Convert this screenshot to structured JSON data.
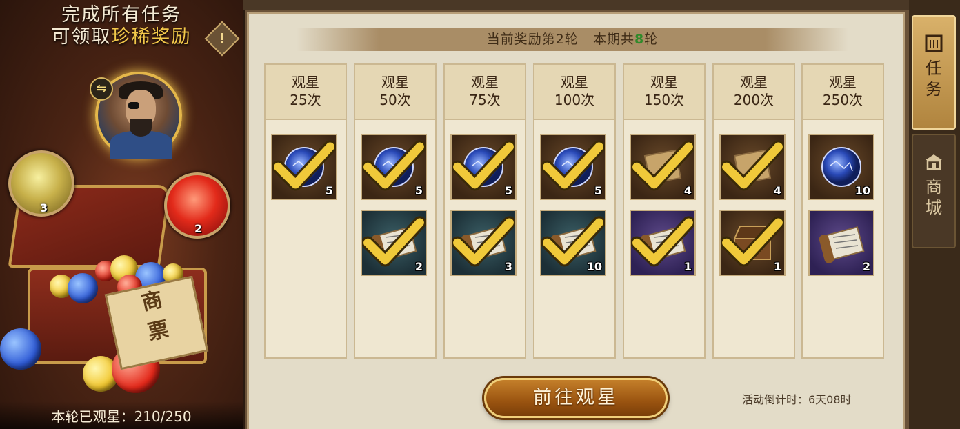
{
  "left_panel": {
    "title_line1": "完成所有任务",
    "title_line2_prefix": "可领取",
    "title_line2_highlight": "珍稀奖励",
    "warning_glyph": "!",
    "swap_glyph": "⇋",
    "gold_orb_count": "3",
    "red_orb_count": "2",
    "ticket_text_1": "商",
    "ticket_text_2": "票",
    "progress_text": "本轮已观星：210/250"
  },
  "banner": {
    "prefix": "当前奖励第2轮",
    "middle": "本期共",
    "total": "8",
    "suffix": "轮"
  },
  "columns": [
    {
      "line1": "观星",
      "line2": "25次",
      "items": [
        {
          "type": "star-orb",
          "bg": "brown",
          "count": "5"
        }
      ]
    },
    {
      "line1": "观星",
      "line2": "50次",
      "items": [
        {
          "type": "star-orb",
          "bg": "brown",
          "count": "5"
        },
        {
          "type": "scroll",
          "bg": "teal",
          "count": "2"
        }
      ]
    },
    {
      "line1": "观星",
      "line2": "75次",
      "items": [
        {
          "type": "star-orb",
          "bg": "brown",
          "count": "5"
        },
        {
          "type": "scroll",
          "bg": "teal",
          "count": "3"
        }
      ]
    },
    {
      "line1": "观星",
      "line2": "100次",
      "items": [
        {
          "type": "star-orb",
          "bg": "brown",
          "count": "5"
        },
        {
          "type": "scroll",
          "bg": "teal",
          "count": "10"
        }
      ]
    },
    {
      "line1": "观星",
      "line2": "150次",
      "items": [
        {
          "type": "paper",
          "bg": "brown",
          "count": "4"
        },
        {
          "type": "scroll",
          "bg": "purple",
          "count": "1"
        }
      ]
    },
    {
      "line1": "观星",
      "line2": "200次",
      "items": [
        {
          "type": "paper",
          "bg": "brown",
          "count": "4"
        },
        {
          "type": "chest",
          "bg": "brown",
          "count": "1"
        }
      ]
    },
    {
      "line1": "观星",
      "line2": "250次",
      "items": [
        {
          "type": "star-orb",
          "bg": "brown",
          "count": "10",
          "claimed": false
        },
        {
          "type": "scroll",
          "bg": "purple",
          "count": "2",
          "claimed": false
        }
      ]
    }
  ],
  "go_button_label": "前往观星",
  "countdown_text": "活动倒计时：6天08时",
  "side_tabs": [
    {
      "label_1": "任",
      "label_2": "务",
      "icon": "scroll-icon",
      "active": true
    },
    {
      "label_1": "商",
      "label_2": "城",
      "icon": "shop-icon",
      "active": false
    }
  ],
  "colors": {
    "highlight_gold": "#f2c84a",
    "banner_green": "#2f8a2a",
    "check_gold": "#f0c93a"
  }
}
